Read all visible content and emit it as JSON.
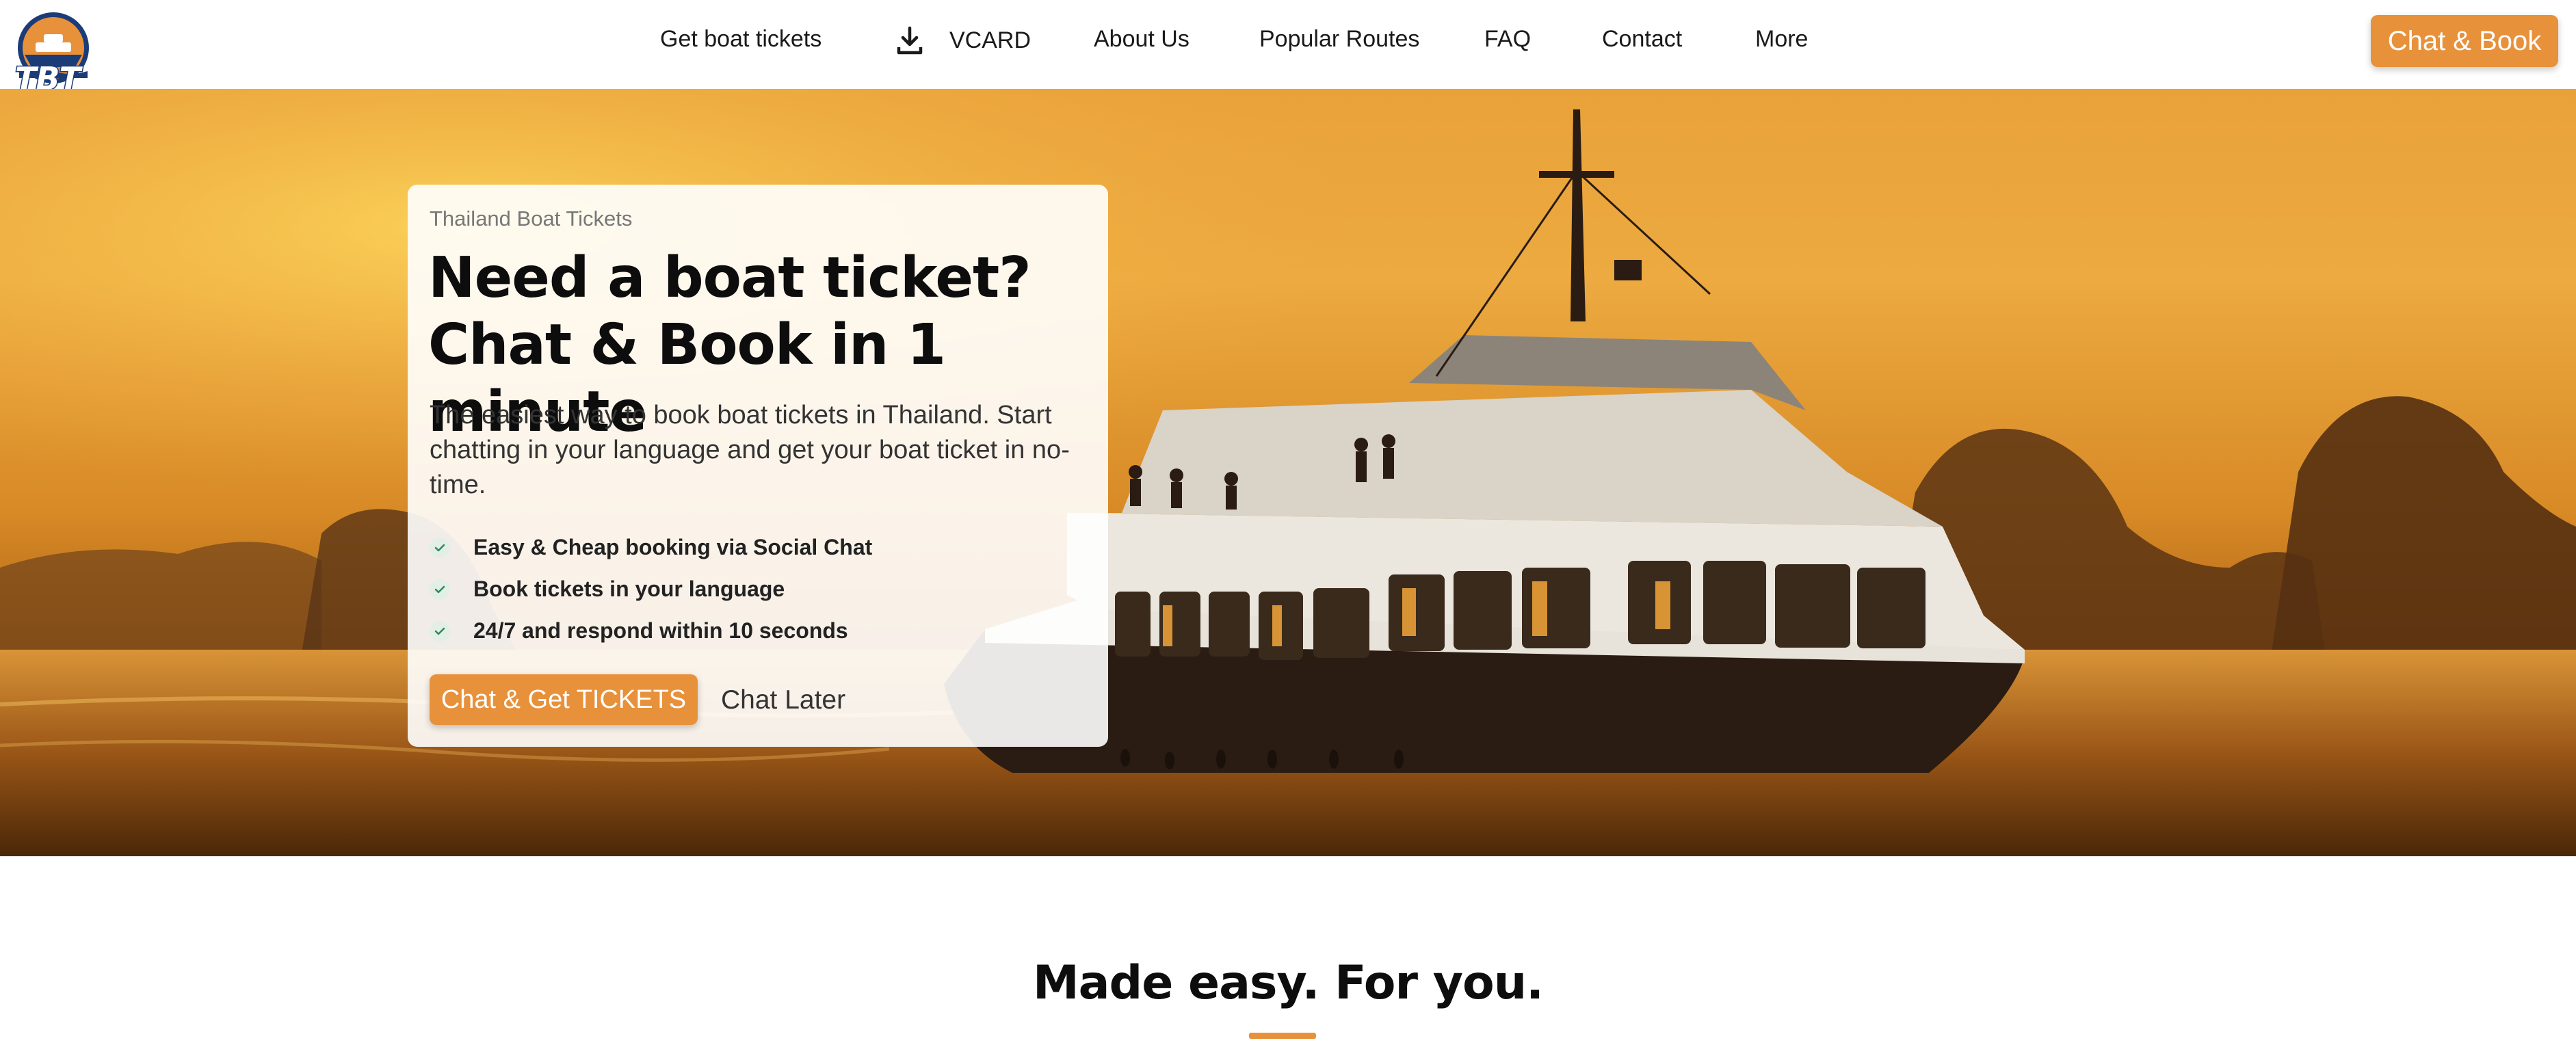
{
  "brand": {
    "logo_text": "TBT"
  },
  "nav": {
    "items": [
      {
        "label": "Get boat tickets"
      },
      {
        "label": "VCARD",
        "icon": "download-icon"
      },
      {
        "label": "About Us"
      },
      {
        "label": "Popular Routes"
      },
      {
        "label": "FAQ"
      },
      {
        "label": "Contact"
      },
      {
        "label": "More"
      }
    ],
    "cta_label": "Chat & Book"
  },
  "hero": {
    "eyebrow": "Thailand Boat Tickets",
    "title_line1": "Need a boat ticket?",
    "title_line2": "Chat & Book in 1 minute",
    "description": "The easiest way to book boat tickets in Thailand. Start chatting in your language and get your boat ticket in no-time.",
    "features": [
      "Easy & Cheap booking via Social Chat",
      "Book tickets in your language",
      "24/7 and respond within 10 seconds"
    ],
    "primary_button": "Chat & Get TICKETS",
    "secondary_link": "Chat Later"
  },
  "section": {
    "title": "Made easy. For you."
  },
  "colors": {
    "accent": "#e8913b",
    "logo_navy": "#1c3c78",
    "check_green": "#2e8b57"
  }
}
